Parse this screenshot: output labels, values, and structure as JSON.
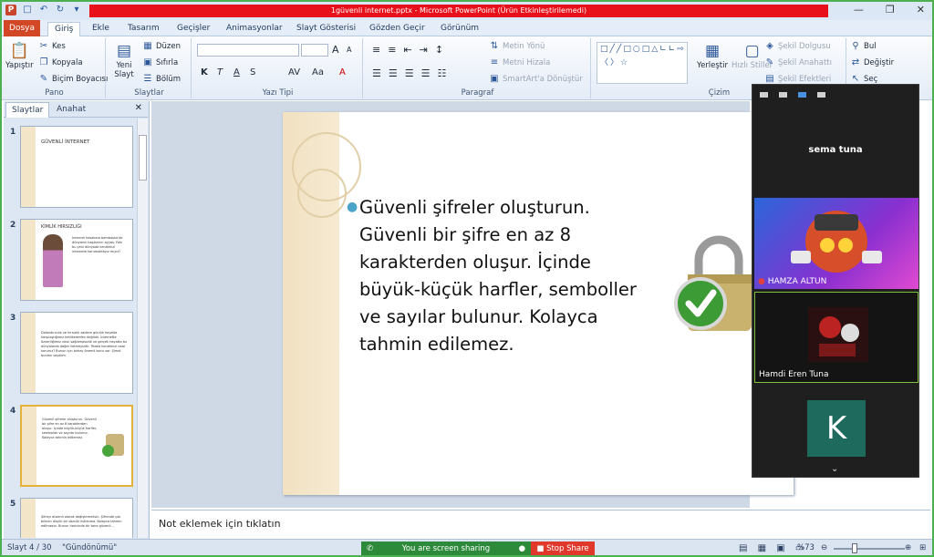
{
  "window": {
    "title": "1güvenli internet.pptx - Microsoft PowerPoint (Ürün Etkinleştirilemedi)",
    "qat_icons": [
      "powerpoint-logo-icon",
      "save-icon",
      "undo-icon",
      "redo-icon",
      "customize-icon"
    ],
    "logo_letter": "P"
  },
  "tabs": [
    {
      "label": "Dosya"
    },
    {
      "label": "Giriş"
    },
    {
      "label": "Ekle"
    },
    {
      "label": "Tasarım"
    },
    {
      "label": "Geçişler"
    },
    {
      "label": "Animasyonlar"
    },
    {
      "label": "Slayt Gösterisi"
    },
    {
      "label": "Gözden Geçir"
    },
    {
      "label": "Görünüm"
    }
  ],
  "ribbon": {
    "pano": {
      "label": "Pano",
      "paste": "Yapıştır",
      "cut": "Kes",
      "copy": "Kopyala",
      "format_painter": "Biçim Boyacısı"
    },
    "slaytlar": {
      "label": "Slaytlar",
      "new_slide": "Yeni Slayt",
      "layout": "Düzen",
      "reset": "Sıfırla",
      "section": "Bölüm"
    },
    "yazi_tipi": {
      "label": "Yazı Tipi",
      "bold": "K",
      "italic": "T",
      "underline": "A",
      "strike": "S",
      "spacing": "AV",
      "case": "Aa",
      "grow": "A",
      "shrink": "A",
      "color": "A"
    },
    "paragraf": {
      "label": "Paragraf",
      "text_direction": "Metin Yönü",
      "align_text": "Metni Hizala",
      "smartart": "SmartArt'a Dönüştür"
    },
    "cizim": {
      "label": "Çizim",
      "arrange": "Yerleştir",
      "quick_styles": "Hızlı Stiller",
      "shape_fill": "Şekil Dolgusu",
      "shape_outline": "Şekil Anahattı",
      "shape_effects": "Şekil Efektleri"
    },
    "duzenleme": {
      "find": "Bul",
      "replace": "Değiştir",
      "select": "Seç"
    }
  },
  "panel": {
    "tabs": [
      "Slaytlar",
      "Anahat"
    ],
    "slides": [
      {
        "num": "1",
        "title": "GÜVENLİ İNTERNET",
        "body": ""
      },
      {
        "num": "2",
        "title": "KİMLİK HIRSIZLIĞI",
        "body": "İnternet hesabına bambaşka bir dünyanın başlarının ayyaş. Fakı bu yeni dünyada kendimizi internete korumaktayız mıyız?"
      },
      {
        "num": "3",
        "title": "",
        "body": "Dolandırıcılık ve hırsızlık sadece günlük hayatta karşılaştığımız tehlikelerden değildir. İnternette özveriliğimiz nasıl sağlamasızlık ve gerçek hayatta bu dünyalarda değer iletmeyizdir. Parola kendimizi nasıl koruruz? Bunun için birkaç önemli konu var. Şimdi bunları sayalım."
      },
      {
        "num": "4",
        "title": "",
        "body": "Güvenli şifreler oluşturun. Güvenli bir şifre en az 8 karakterden oluşur. İçinde büyük-küçük harfler, semboller ve sayılar bulunur. Kolayca tahmin edilemez."
      },
      {
        "num": "5",
        "title": "",
        "body": "Şifreyi düzenli olarak değiştirmelisin. Şifrende çok bilinen düşük bir sözcük kullanma. Kolayca tahmin edilmesin. Bunun haricinde bir tane güvenli..."
      }
    ]
  },
  "slide": {
    "bullet": "Güvenli şifreler oluşturun. Güvenli bir şifre en az 8 karakterden oluşur. İçinde büyük-küçük harfler, semboller ve sayılar bulunur. Kolayca tahmin edilemez."
  },
  "notes": {
    "placeholder": "Not eklemek için tıklatın"
  },
  "status": {
    "slide": "Slayt 4 / 30",
    "theme": "\"Gündönümü\"",
    "sharing": "You are screen sharing",
    "stop": "Stop Share",
    "zoom": "%73"
  },
  "zoom": {
    "self_name": "sema tuna",
    "participants": [
      {
        "name": "HAMZA ALTUN"
      },
      {
        "name": "Hamdi Eren Tuna"
      },
      {
        "name": "",
        "initial": "K"
      }
    ]
  },
  "colors": {
    "accent": "#d24726",
    "share_green": "#2d8a3a",
    "stop_red": "#e0392c",
    "title_red": "#e8101b"
  }
}
